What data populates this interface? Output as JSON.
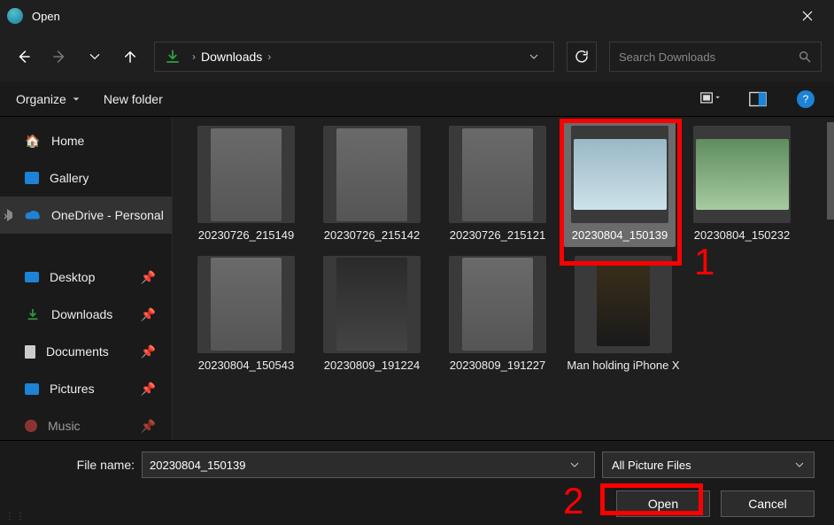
{
  "window": {
    "title": "Open"
  },
  "nav": {
    "location": "Downloads",
    "search_placeholder": "Search Downloads"
  },
  "toolbar": {
    "organize": "Organize",
    "new_folder": "New folder"
  },
  "sidebar": {
    "items": [
      {
        "label": "Home"
      },
      {
        "label": "Gallery"
      },
      {
        "label": "OneDrive - Personal"
      },
      {
        "label": "Desktop"
      },
      {
        "label": "Downloads"
      },
      {
        "label": "Documents"
      },
      {
        "label": "Pictures"
      },
      {
        "label": "Music"
      }
    ]
  },
  "files": {
    "items": [
      {
        "name": "20230726_215149"
      },
      {
        "name": "20230726_215142"
      },
      {
        "name": "20230726_215121"
      },
      {
        "name": "20230804_150139",
        "selected": true
      },
      {
        "name": "20230804_150232"
      },
      {
        "name": "20230804_150543"
      },
      {
        "name": "20230809_191224"
      },
      {
        "name": "20230809_191227"
      },
      {
        "name": "Man holding iPhone X"
      }
    ]
  },
  "footer": {
    "filename_label": "File name:",
    "filename_value": "20230804_150139",
    "filter": "All Picture Files",
    "open": "Open",
    "cancel": "Cancel"
  },
  "annotations": {
    "one": "1",
    "two": "2"
  }
}
